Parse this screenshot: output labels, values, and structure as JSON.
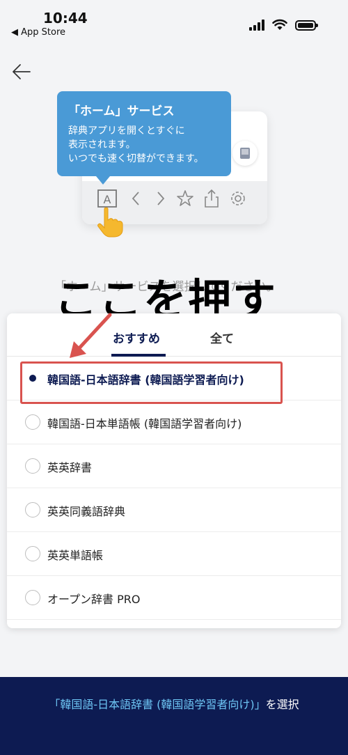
{
  "status_bar": {
    "time": "10:44",
    "back_app": "◀ App Store"
  },
  "illustration": {
    "tooltip_title": "「ホーム」サービス",
    "tooltip_lines": [
      "辞典アプリを開くとすぐに",
      "表示されます。",
      "いつでも速く切替ができます。"
    ],
    "home_icon_letter": "A"
  },
  "instruction": "「ホーム」サービスを選択してください。",
  "overlay_caption": "ここを押す",
  "tabs": [
    {
      "label": "おすすめ",
      "active": true
    },
    {
      "label": "全て",
      "active": false
    }
  ],
  "options": [
    {
      "label": "韓国語-日本語辞書 (韓国語学習者向け)",
      "selected": true
    },
    {
      "label": "韓国語-日本単語帳 (韓国語学習者向け)",
      "selected": false
    },
    {
      "label": "英英辞書",
      "selected": false
    },
    {
      "label": "英英同義語辞典",
      "selected": false
    },
    {
      "label": "英英単語帳",
      "selected": false
    },
    {
      "label": "オープン辞書 PRO",
      "selected": false
    }
  ],
  "footer": {
    "highlight": "「韓国語-日本語辞書 (韓国語学習者向け)」",
    "suffix": "を選択"
  },
  "colors": {
    "navy": "#0d1b52",
    "tooltip_blue": "#4a9ad6",
    "highlight_red": "#d9534f",
    "footer_highlight": "#6ec6f5"
  }
}
